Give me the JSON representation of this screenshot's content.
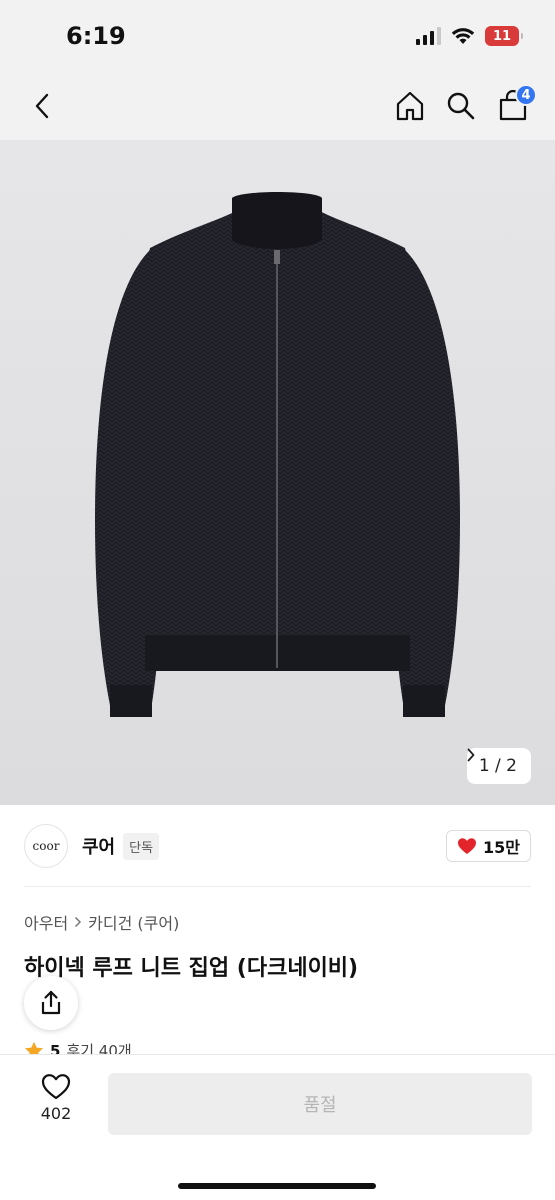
{
  "status_bar": {
    "time": "6:19",
    "battery": "11"
  },
  "nav": {
    "cart_count": "4"
  },
  "image": {
    "counter": "1 / 2"
  },
  "brand": {
    "logo_text": "coor",
    "name": "쿠어",
    "tag": "단독",
    "likes": "15만"
  },
  "breadcrumb": {
    "category": "아우터",
    "subcategory": "카디건 (쿠어)"
  },
  "product": {
    "title": "하이넥 루프 니트 집업 (다크네이비)",
    "rating": "5",
    "reviews": "후기 40개"
  },
  "bottom_bar": {
    "wish_count": "402",
    "purchase_label": "품절"
  },
  "colors": {
    "accent": "#3476f2",
    "heart": "#e3242b",
    "battery": "#d93a3a"
  }
}
